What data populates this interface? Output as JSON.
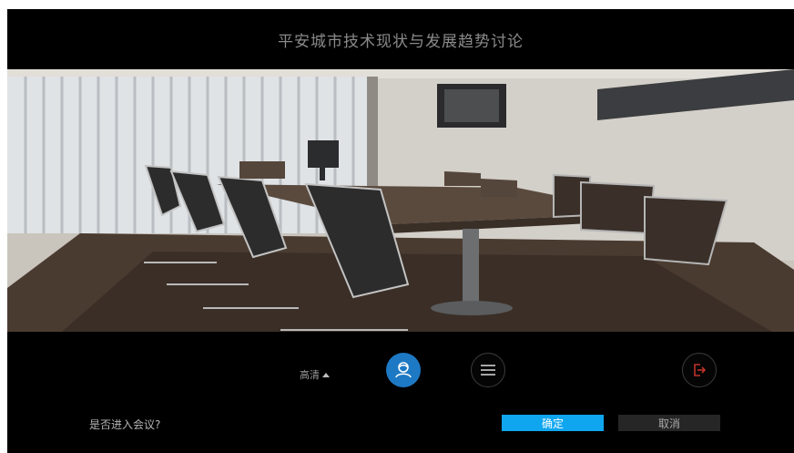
{
  "meeting": {
    "title": "平安城市技术现状与发展趋势讨论"
  },
  "video": {
    "description_icon": "conference-room-photo"
  },
  "controls": {
    "quality_label": "高清",
    "quality_icon": "caret-up-icon",
    "participants_icon": "participants-icon",
    "menu_icon": "menu-icon",
    "exit_icon": "exit-icon",
    "accent_color": "#1e79c4",
    "exit_color": "#c0322a"
  },
  "prompt": {
    "question": "是否进入会议?",
    "confirm_label": "确定",
    "cancel_label": "取消",
    "confirm_color": "#0fa6ef"
  }
}
